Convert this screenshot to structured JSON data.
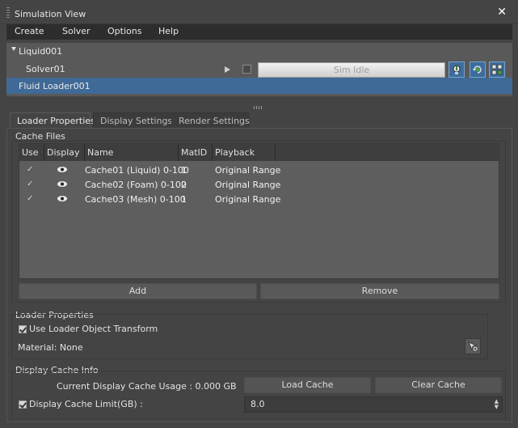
{
  "window": {
    "title": "Simulation View"
  },
  "menu": [
    "Create",
    "Solver",
    "Options",
    "Help"
  ],
  "tree": {
    "liquid": "Liquid001",
    "solver": "Solver01",
    "status": "Sim Idle",
    "loader": "Fluid Loader001"
  },
  "tabs": [
    "Loader Properties",
    "Display Settings",
    "Render Settings"
  ],
  "cache_files": {
    "label": "Cache Files",
    "columns": [
      "Use",
      "Display",
      "Name",
      "MatID",
      "Playback"
    ],
    "rows": [
      {
        "name": "Cache01 (Liquid) 0-100",
        "matid": "1",
        "playback": "Original Range"
      },
      {
        "name": "Cache02 (Foam) 0-100",
        "matid": "2",
        "playback": "Original Range"
      },
      {
        "name": "Cache03 (Mesh) 0-100",
        "matid": "1",
        "playback": "Original Range"
      }
    ],
    "add_label": "Add",
    "remove_label": "Remove"
  },
  "loader_properties": {
    "label": "Loader Properties",
    "use_transform_label": "Use Loader Object Transform",
    "material_label": "Material: None"
  },
  "display_cache": {
    "label": "Display Cache Info",
    "usage_label": "Current Display Cache Usage : 0.000 GB",
    "load_label": "Load Cache",
    "clear_label": "Clear Cache",
    "limit_label": "Display Cache Limit(GB) :",
    "limit_value": "8.0"
  },
  "colors": {
    "selection": "#3f6a97",
    "tool_button": "#3c6d9e",
    "panel": "#444444"
  },
  "icons": [
    "close-icon",
    "expand-triangle-icon",
    "play-icon",
    "lightbulb-icon",
    "refresh-icon",
    "gear-icon",
    "check-icon",
    "eye-icon",
    "pick-object-icon",
    "spinner-arrows-icon"
  ]
}
